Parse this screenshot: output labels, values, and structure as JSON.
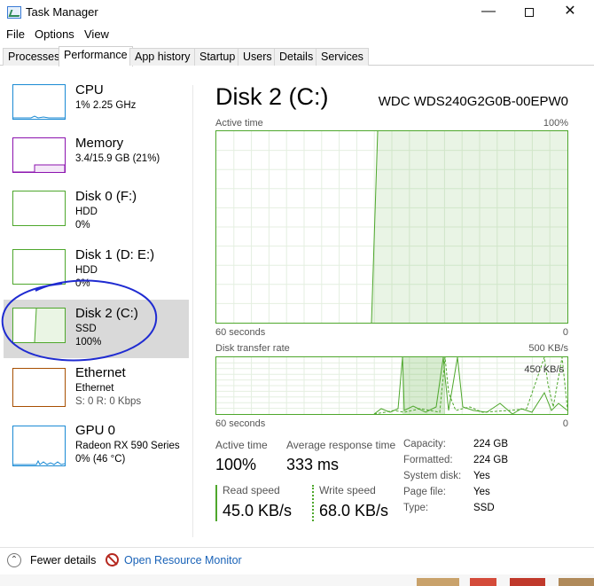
{
  "window": {
    "title": "Task Manager",
    "minimize": "—",
    "close": "✕"
  },
  "menu": [
    "File",
    "Options",
    "View"
  ],
  "tabs": [
    "Processes",
    "Performance",
    "App history",
    "Startup",
    "Users",
    "Details",
    "Services"
  ],
  "active_tab": "Performance",
  "resources": [
    {
      "name": "CPU",
      "lines": [
        "1% 2.25 GHz"
      ],
      "color": "#1a8ad4"
    },
    {
      "name": "Memory",
      "lines": [
        "3.4/15.9 GB (21%)"
      ],
      "color": "#8b12ae"
    },
    {
      "name": "Disk 0 (F:)",
      "lines": [
        "HDD",
        "0%"
      ],
      "color": "#4ea72c"
    },
    {
      "name": "Disk 1 (D: E:)",
      "lines": [
        "HDD",
        "0%"
      ],
      "color": "#4ea72c"
    },
    {
      "name": "Disk 2 (C:)",
      "lines": [
        "SSD",
        "100%"
      ],
      "color": "#4ea72c",
      "selected": true
    },
    {
      "name": "Ethernet",
      "lines": [
        "Ethernet",
        "S: 0 R: 0 Kbps"
      ],
      "color": "#a74f01"
    },
    {
      "name": "GPU 0",
      "lines": [
        "Radeon RX 590 Series",
        "0% (46 °C)"
      ],
      "color": "#1a8ad4"
    }
  ],
  "detail": {
    "title": "Disk 2 (C:)",
    "model": "WDC WDS240G2G0B-00EPW0",
    "active_graph": {
      "label": "Active time",
      "max": "100%",
      "time_label": "60 seconds",
      "min": "0",
      "active_value": 1.0
    },
    "transfer_graph": {
      "label": "Disk transfer rate",
      "max": "500 KB/s",
      "marker": "450 KB/s",
      "time_label": "60 seconds",
      "min": "0"
    },
    "stats": {
      "active_time_label": "Active time",
      "active_time": "100%",
      "avg_response_label": "Average response time",
      "avg_response": "333 ms",
      "read_label": "Read speed",
      "read": "45.0 KB/s",
      "write_label": "Write speed",
      "write": "68.0 KB/s"
    },
    "properties": [
      {
        "label": "Capacity:",
        "value": "224 GB"
      },
      {
        "label": "Formatted:",
        "value": "224 GB"
      },
      {
        "label": "System disk:",
        "value": "Yes"
      },
      {
        "label": "Page file:",
        "value": "Yes"
      },
      {
        "label": "Type:",
        "value": "SSD"
      }
    ]
  },
  "footer": {
    "fewer_details": "Fewer details",
    "open_monitor": "Open Resource Monitor"
  },
  "colors": {
    "disk": "#4ea72c",
    "annotation": "#1f2bd1",
    "link": "#1a63b8"
  }
}
